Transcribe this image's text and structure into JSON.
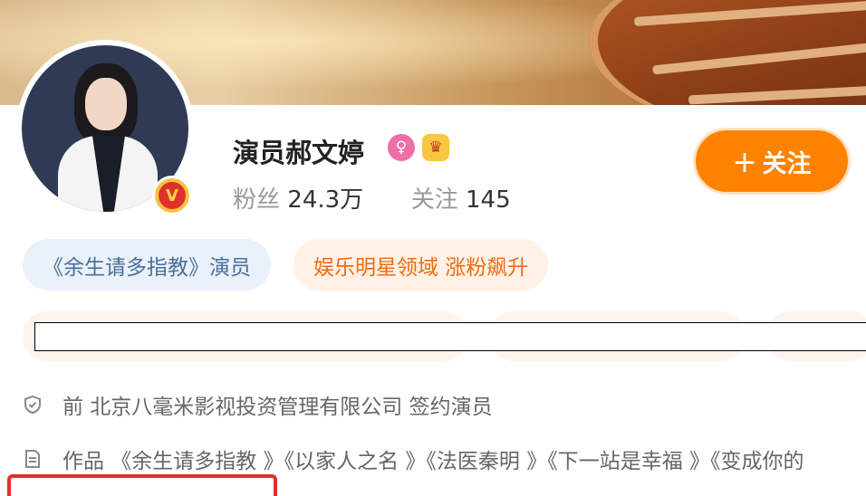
{
  "profile": {
    "name": "演员郝文婷",
    "stats": {
      "fans_label": "粉丝",
      "fans_value": "24.3万",
      "following_label": "关注",
      "following_value": "145"
    },
    "follow_button": {
      "icon": "plus-icon",
      "label": "关注"
    },
    "verified_badge": "V"
  },
  "tags": [
    {
      "label": "《余生请多指教》演员"
    },
    {
      "label": "娱乐明星领域 涨粉飙升"
    }
  ],
  "info": [
    {
      "icon": "shield-icon",
      "text": "前 北京八毫米影视投资管理有限公司 签约演员"
    },
    {
      "icon": "document-icon",
      "text": "作品 《余生请多指教 》《以家人之名 》《法医秦明 》《下一站是幸福 》《变成你的"
    }
  ],
  "colors": {
    "accent": "#ff8200",
    "tag_blue_bg": "#eaf1fb",
    "tag_orange_bg": "#fff1e6",
    "highlight_red": "#e0302b"
  }
}
